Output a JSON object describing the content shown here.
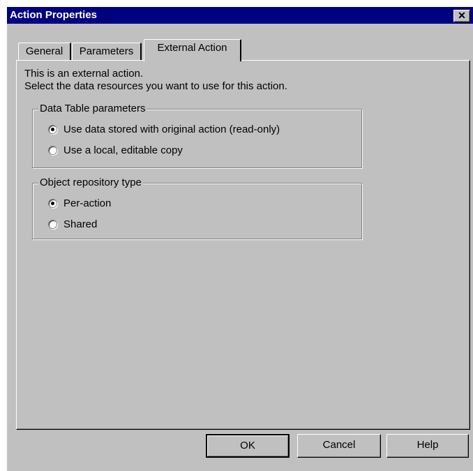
{
  "window": {
    "title": "Action Properties",
    "close_glyph": "✕"
  },
  "tabs": [
    {
      "label": "General",
      "active": false
    },
    {
      "label": "Parameters",
      "active": false
    },
    {
      "label": "External Action",
      "active": true
    }
  ],
  "intro": {
    "line1": "This is an external action.",
    "line2": "Select the data resources you want to use for this action."
  },
  "data_table": {
    "label": "Data Table parameters",
    "options": [
      {
        "label": "Use data stored with original action (read-only)",
        "selected": true
      },
      {
        "label": "Use a local, editable copy",
        "selected": false
      }
    ]
  },
  "object_repository": {
    "label": "Object repository type",
    "options": [
      {
        "label": "Per-action",
        "selected": true
      },
      {
        "label": "Shared",
        "selected": false
      }
    ]
  },
  "buttons": {
    "ok": "OK",
    "cancel": "Cancel",
    "help": "Help"
  },
  "colors": {
    "title_bar": "#000080",
    "dialog_bg": "#c0c0c0"
  }
}
